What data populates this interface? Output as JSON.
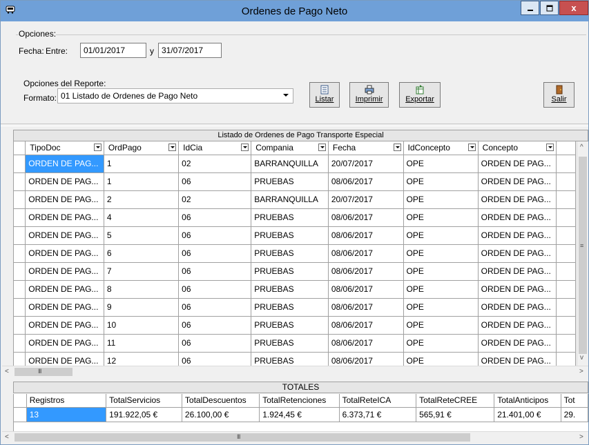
{
  "window": {
    "title": "Ordenes de Pago Neto",
    "app_icon": "bus-icon",
    "controls": [
      "minimize",
      "maximize",
      "close"
    ],
    "close_glyph": "x"
  },
  "opciones": {
    "group_label": "Opciones:",
    "fecha_label": "Fecha:",
    "entre_label": "Entre:",
    "fecha_desde": "01/01/2017",
    "y_label": "y",
    "fecha_hasta": "31/07/2017"
  },
  "reporte": {
    "group_label": "Opciones del Reporte:",
    "formato_label": "Formato:",
    "formato_value": "01 Listado de Ordenes de Pago Neto"
  },
  "toolbar": {
    "listar": "Listar",
    "imprimir": "Imprimir",
    "exportar": "Exportar",
    "salir": "Salir"
  },
  "listado": {
    "caption": "Listado de Ordenes de Pago Transporte Especial",
    "columns": [
      "TipoDoc",
      "OrdPago",
      "IdCia",
      "Compania",
      "Fecha",
      "IdConcepto",
      "Concepto"
    ],
    "rows": [
      [
        "ORDEN DE PAG...",
        "1",
        "02",
        "BARRANQUILLA",
        "20/07/2017",
        "OPE",
        "ORDEN DE PAG..."
      ],
      [
        "ORDEN DE PAG...",
        "1",
        "06",
        "PRUEBAS",
        "08/06/2017",
        "OPE",
        "ORDEN DE PAG..."
      ],
      [
        "ORDEN DE PAG...",
        "2",
        "02",
        "BARRANQUILLA",
        "20/07/2017",
        "OPE",
        "ORDEN DE PAG..."
      ],
      [
        "ORDEN DE PAG...",
        "4",
        "06",
        "PRUEBAS",
        "08/06/2017",
        "OPE",
        "ORDEN DE PAG..."
      ],
      [
        "ORDEN DE PAG...",
        "5",
        "06",
        "PRUEBAS",
        "08/06/2017",
        "OPE",
        "ORDEN DE PAG..."
      ],
      [
        "ORDEN DE PAG...",
        "6",
        "06",
        "PRUEBAS",
        "08/06/2017",
        "OPE",
        "ORDEN DE PAG..."
      ],
      [
        "ORDEN DE PAG...",
        "7",
        "06",
        "PRUEBAS",
        "08/06/2017",
        "OPE",
        "ORDEN DE PAG..."
      ],
      [
        "ORDEN DE PAG...",
        "8",
        "06",
        "PRUEBAS",
        "08/06/2017",
        "OPE",
        "ORDEN DE PAG..."
      ],
      [
        "ORDEN DE PAG...",
        "9",
        "06",
        "PRUEBAS",
        "08/06/2017",
        "OPE",
        "ORDEN DE PAG..."
      ],
      [
        "ORDEN DE PAG...",
        "10",
        "06",
        "PRUEBAS",
        "08/06/2017",
        "OPE",
        "ORDEN DE PAG..."
      ],
      [
        "ORDEN DE PAG...",
        "11",
        "06",
        "PRUEBAS",
        "08/06/2017",
        "OPE",
        "ORDEN DE PAG..."
      ],
      [
        "ORDEN DE PAG...",
        "12",
        "06",
        "PRUEBAS",
        "08/06/2017",
        "OPE",
        "ORDEN DE PAG..."
      ]
    ],
    "hscroll_grip": "III"
  },
  "totales": {
    "caption": "TOTALES",
    "columns": [
      "Registros",
      "TotalServicios",
      "TotalDescuentos",
      "TotalRetenciones",
      "TotalReteICA",
      "TotalReteCREE",
      "TotalAnticipos",
      "Tot"
    ],
    "row": [
      "13",
      "191.922,05 €",
      "26.100,00 €",
      "1.924,45 €",
      "6.373,71 €",
      "565,91 €",
      "21.401,00 €",
      "29."
    ],
    "hscroll_grip": "III"
  },
  "colors": {
    "titlebar": "#6fa0d8",
    "selection": "#3399ff",
    "close_button": "#c75050"
  }
}
